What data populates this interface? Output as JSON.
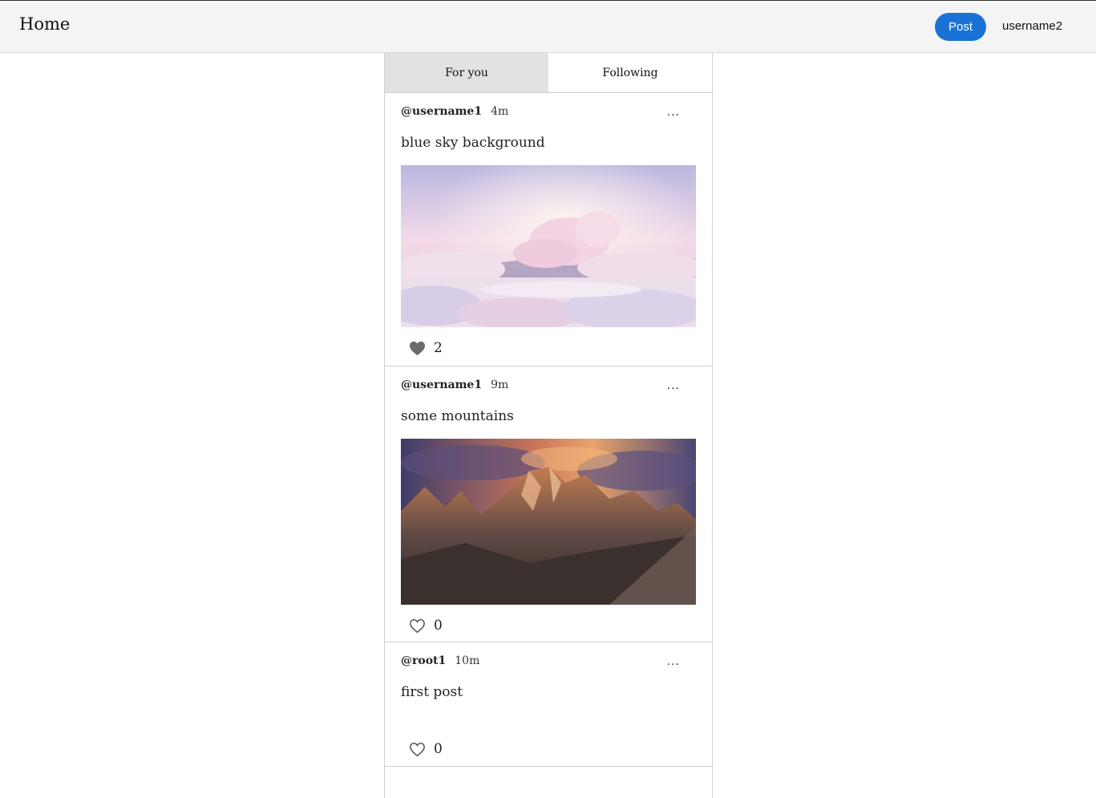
{
  "header": {
    "title": "Home",
    "post_label": "Post",
    "username": "username2"
  },
  "tabs": [
    {
      "label": "For you",
      "active": true
    },
    {
      "label": "Following",
      "active": false
    }
  ],
  "posts": [
    {
      "author": "@username1",
      "time": "4m",
      "more": "...",
      "text": "blue sky background",
      "image": "pink-cloud-sky-image",
      "liked": true,
      "likes": "2"
    },
    {
      "author": "@username1",
      "time": "9m",
      "more": "...",
      "text": "some mountains",
      "image": "sunset-mountains-image",
      "liked": false,
      "likes": "0"
    },
    {
      "author": "@root1",
      "time": "10m",
      "more": "...",
      "text": "first post",
      "image": "",
      "liked": false,
      "likes": "0"
    }
  ],
  "colors": {
    "accent": "#1a73d4",
    "heart_filled": "#6b6b6b",
    "heart_outline": "#555555"
  }
}
